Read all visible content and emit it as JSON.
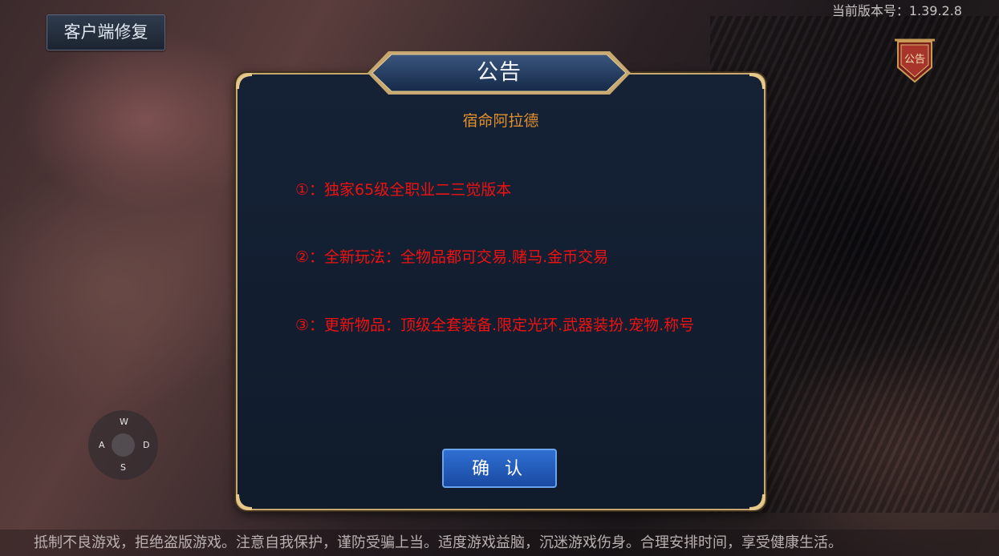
{
  "header": {
    "repair_button": "客户端修复",
    "version": "当前版本号：1.39.2.8",
    "notice_badge": "公告"
  },
  "dialog": {
    "title": "公告",
    "subtitle": "宿命阿拉德",
    "lines": [
      "①：独家65级全职业二三觉版本",
      "②：全新玩法：全物品都可交易.赌马.金币交易",
      "③：更新物品：顶级全套装备.限定光环.武器装扮.宠物.称号"
    ],
    "confirm_button": "确 认"
  },
  "joystick": {
    "up": "W",
    "left": "A",
    "right": "D",
    "down": "S"
  },
  "footer": {
    "text": "抵制不良游戏，拒绝盗版游戏。注意自我保护，谨防受骗上当。适度游戏益脑，沉迷游戏伤身。合理安排时间，享受健康生活。"
  },
  "colors": {
    "dialog_bg": "#152236",
    "gold_border": "#c7a870",
    "subtitle": "#e1902c",
    "notice_text": "#ee1212",
    "button_blue": "#1a4aa2"
  }
}
